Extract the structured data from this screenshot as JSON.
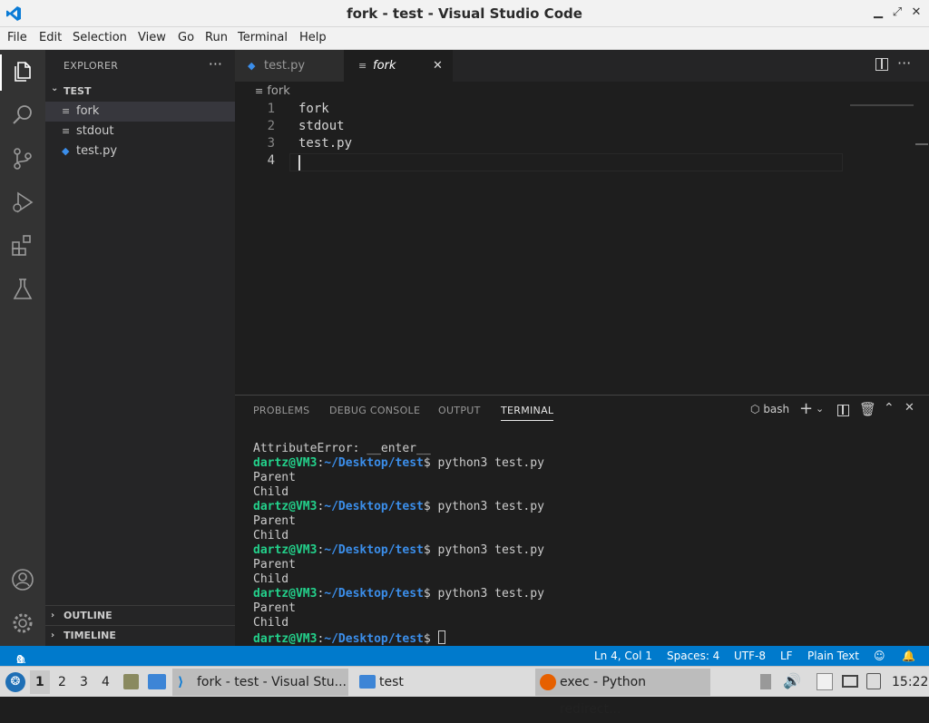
{
  "window": {
    "title": "fork - test - Visual Studio Code"
  },
  "menu": [
    "File",
    "Edit",
    "Selection",
    "View",
    "Go",
    "Run",
    "Terminal",
    "Help"
  ],
  "explorer": {
    "header": "EXPLORER",
    "folder": "TEST",
    "files": [
      {
        "name": "fork",
        "icon": "lines-icon",
        "selected": true
      },
      {
        "name": "stdout",
        "icon": "lines-icon",
        "selected": false
      },
      {
        "name": "test.py",
        "icon": "python-icon",
        "selected": false
      }
    ],
    "outline": "OUTLINE",
    "timeline": "TIMELINE"
  },
  "tabs": [
    {
      "label": "test.py",
      "icon": "python-icon"
    },
    {
      "label": "fork",
      "icon": "lines-icon",
      "active": true
    }
  ],
  "breadcrumb": "fork",
  "code": {
    "line_numbers": [
      "1",
      "2",
      "3",
      "4"
    ],
    "lines": [
      "fork",
      "stdout",
      "test.py",
      ""
    ]
  },
  "panel": {
    "tabs": [
      "PROBLEMS",
      "DEBUG CONSOLE",
      "OUTPUT",
      "TERMINAL"
    ],
    "active_tab": "TERMINAL",
    "shell": "bash",
    "terminal": {
      "error_line": "AttributeError: __enter__",
      "user": "dartz@VM3",
      "sep": ":",
      "path": "~/Desktop/test",
      "command": "$ python3 test.py",
      "final_prompt_tail": "$ ",
      "out1": "Parent",
      "out2": "Child"
    }
  },
  "status": {
    "errors": "0",
    "warnings": "0",
    "position": "Ln 4, Col 1",
    "spaces": "Spaces: 4",
    "encoding": "UTF-8",
    "eol": "LF",
    "language": "Plain Text"
  },
  "taskbar": {
    "workspaces": [
      "1",
      "2",
      "3",
      "4"
    ],
    "tasks": [
      "fork - test - Visual Stu...",
      "test",
      "exec - Python redirect..."
    ],
    "clock": "15:22"
  },
  "colors": {
    "accent": "#007acc",
    "prompt_user": "#23d18b",
    "prompt_path": "#3b8eea"
  }
}
